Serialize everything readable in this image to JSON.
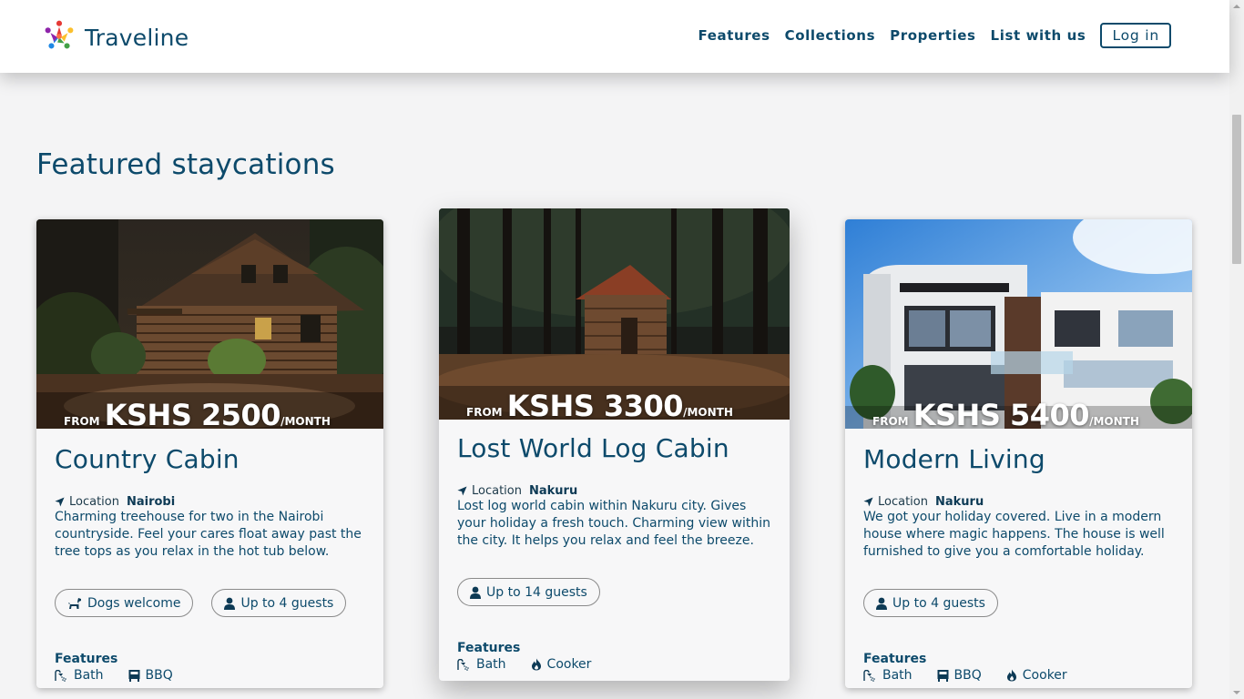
{
  "header": {
    "brand": "Traveline",
    "nav": [
      "Features",
      "Collections",
      "Properties",
      "List with us"
    ],
    "login": "Log in"
  },
  "section": {
    "title": "Featured staycations"
  },
  "cards": [
    {
      "from": "FROM",
      "price": "KSHS 2500",
      "unit": "/MONTH",
      "title": "Country Cabin",
      "location_label": "Location",
      "location": "Nairobi",
      "description": "Charming treehouse for two in the Nairobi countryside. Feel your cares float away past the tree tops as you relax in the hot tub below.",
      "tags": [
        "Dogs welcome",
        "Up to 4 guests"
      ],
      "features_title": "Features",
      "features": [
        "Bath",
        "BBQ"
      ]
    },
    {
      "from": "FROM",
      "price": "KSHS 3300",
      "unit": "/MONTH",
      "title": "Lost World Log Cabin",
      "location_label": "Location",
      "location": "Nakuru",
      "description": "Lost log world cabin within Nakuru city. Gives your holiday a fresh touch. Charming view within the city. It helps you relax and feel the breeze.",
      "tags": [
        "Up to 14 guests"
      ],
      "features_title": "Features",
      "features": [
        "Bath",
        "Cooker"
      ]
    },
    {
      "from": "FROM",
      "price": "KSHS 5400",
      "unit": "/MONTH",
      "title": "Modern Living",
      "location_label": "Location",
      "location": "Nakuru",
      "description": "We got your holiday covered. Live in a modern house where magic happens. The house is well furnished to give you a comfortable holiday.",
      "tags": [
        "Up to 4 guests"
      ],
      "features_title": "Features",
      "features": [
        "Bath",
        "BBQ",
        "Cooker"
      ]
    }
  ],
  "icons": {
    "logo": "colorful-people-circle-logo",
    "location": "location-arrow-icon",
    "dog": "dog-icon",
    "guests": "user-icon",
    "bath": "shower-icon",
    "bbq": "bbq-icon",
    "cooker": "flame-icon"
  },
  "colors": {
    "primary": "#0d4a6b",
    "background": "#f4f4f5"
  }
}
